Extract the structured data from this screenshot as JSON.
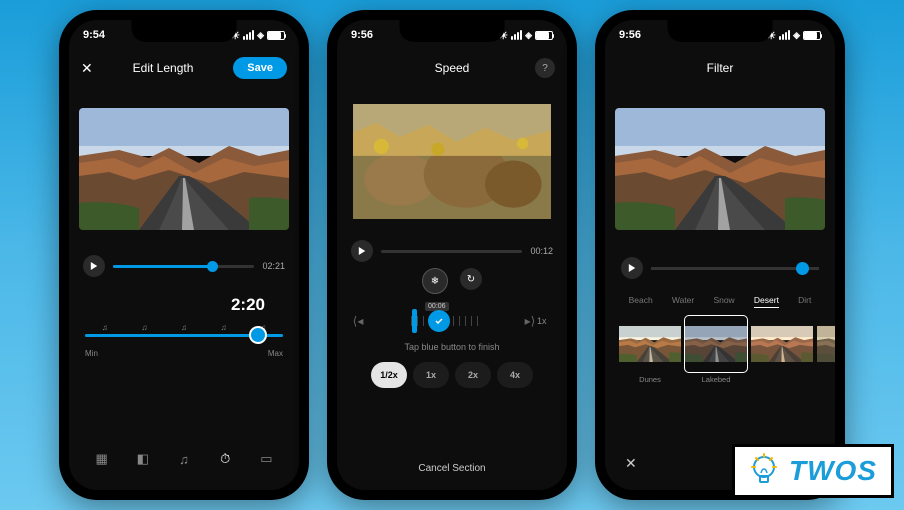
{
  "badge": {
    "text": "TWOS",
    "icon": "lightbulb-icon"
  },
  "phones": [
    {
      "status_time": "9:54",
      "sun_icon": "sun-icon",
      "header": {
        "close": "✕",
        "title": "Edit Length",
        "save": "Save"
      },
      "playback": {
        "percent": 70,
        "total": "02:21"
      },
      "length": {
        "value": "2:20",
        "min_label": "Min",
        "max_label": "Max"
      },
      "tabs": [
        "layers-icon",
        "adjust-icon",
        "music-icon",
        "timer-icon",
        "frame-icon"
      ]
    },
    {
      "status_time": "9:56",
      "sun_icon": "sun-icon",
      "header": {
        "title": "Speed",
        "help": "?"
      },
      "playback": {
        "percent": 0,
        "total": "00:12"
      },
      "freeze_badge": "00:06",
      "hint": "Tap blue button to finish",
      "speed_end_label": "1x",
      "speeds": [
        {
          "label": "1/2x",
          "active": true
        },
        {
          "label": "1x",
          "active": false
        },
        {
          "label": "2x",
          "active": false
        },
        {
          "label": "4x",
          "active": false
        }
      ],
      "cancel": "Cancel Section"
    },
    {
      "status_time": "9:56",
      "sun_icon": "sun-icon",
      "header": {
        "title": "Filter"
      },
      "filter_categories": [
        {
          "label": "Beach",
          "active": false
        },
        {
          "label": "Water",
          "active": false
        },
        {
          "label": "Snow",
          "active": false
        },
        {
          "label": "Desert",
          "active": true
        },
        {
          "label": "Dirt",
          "active": false
        }
      ],
      "filters": [
        {
          "label": "Dunes",
          "active": false
        },
        {
          "label": "Lakebed",
          "active": true
        },
        {
          "label": "",
          "active": false
        }
      ],
      "close": "✕"
    }
  ]
}
